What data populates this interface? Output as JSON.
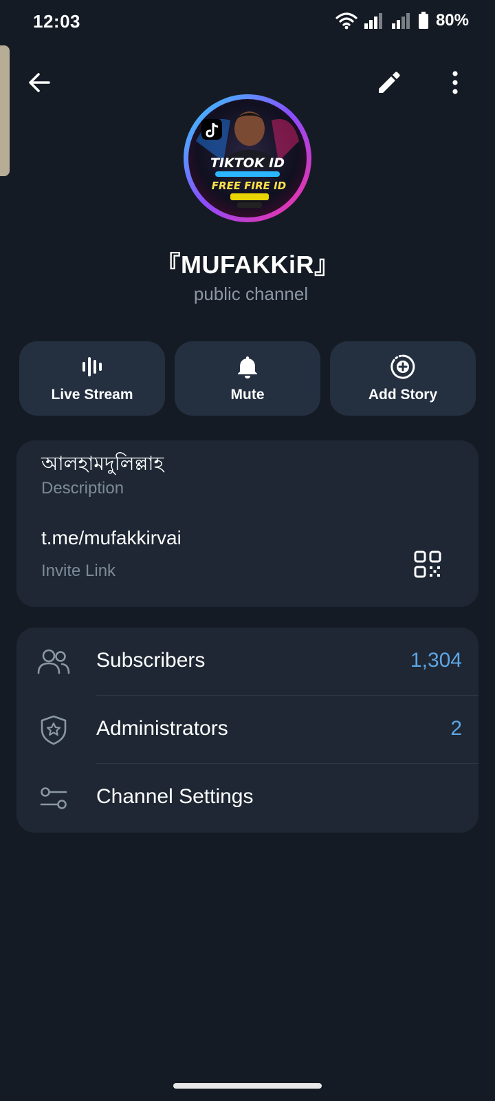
{
  "status_bar": {
    "time": "12:03",
    "battery_percent": "80%"
  },
  "toolbar": {
    "back_icon": "arrow-left-icon",
    "edit_icon": "pencil-icon",
    "more_icon": "more-vertical-icon"
  },
  "profile": {
    "name": "『MUFAKKiR』",
    "subtitle": "public channel",
    "avatar_text": [
      "TIKTOK ID",
      "FREE FIRE ID"
    ]
  },
  "actions": [
    {
      "label": "Live Stream",
      "icon": "live-stream-icon"
    },
    {
      "label": "Mute",
      "icon": "bell-icon"
    },
    {
      "label": "Add Story",
      "icon": "add-story-icon"
    }
  ],
  "info": {
    "description_value": "আলহামদুলিল্লাহ",
    "description_label": "Description",
    "link_value": "t.me/mufakkirvai",
    "link_label": "Invite Link"
  },
  "rows": [
    {
      "label": "Subscribers",
      "value": "1,304",
      "icon": "users-icon"
    },
    {
      "label": "Administrators",
      "value": "2",
      "icon": "shield-star-icon"
    },
    {
      "label": "Channel Settings",
      "value": "",
      "icon": "sliders-icon"
    }
  ],
  "colors": {
    "background": "#151b24",
    "card": "#1e2733",
    "action_button": "#243040",
    "accent_value": "#5ea6e6",
    "secondary_text": "#7d8a99"
  }
}
